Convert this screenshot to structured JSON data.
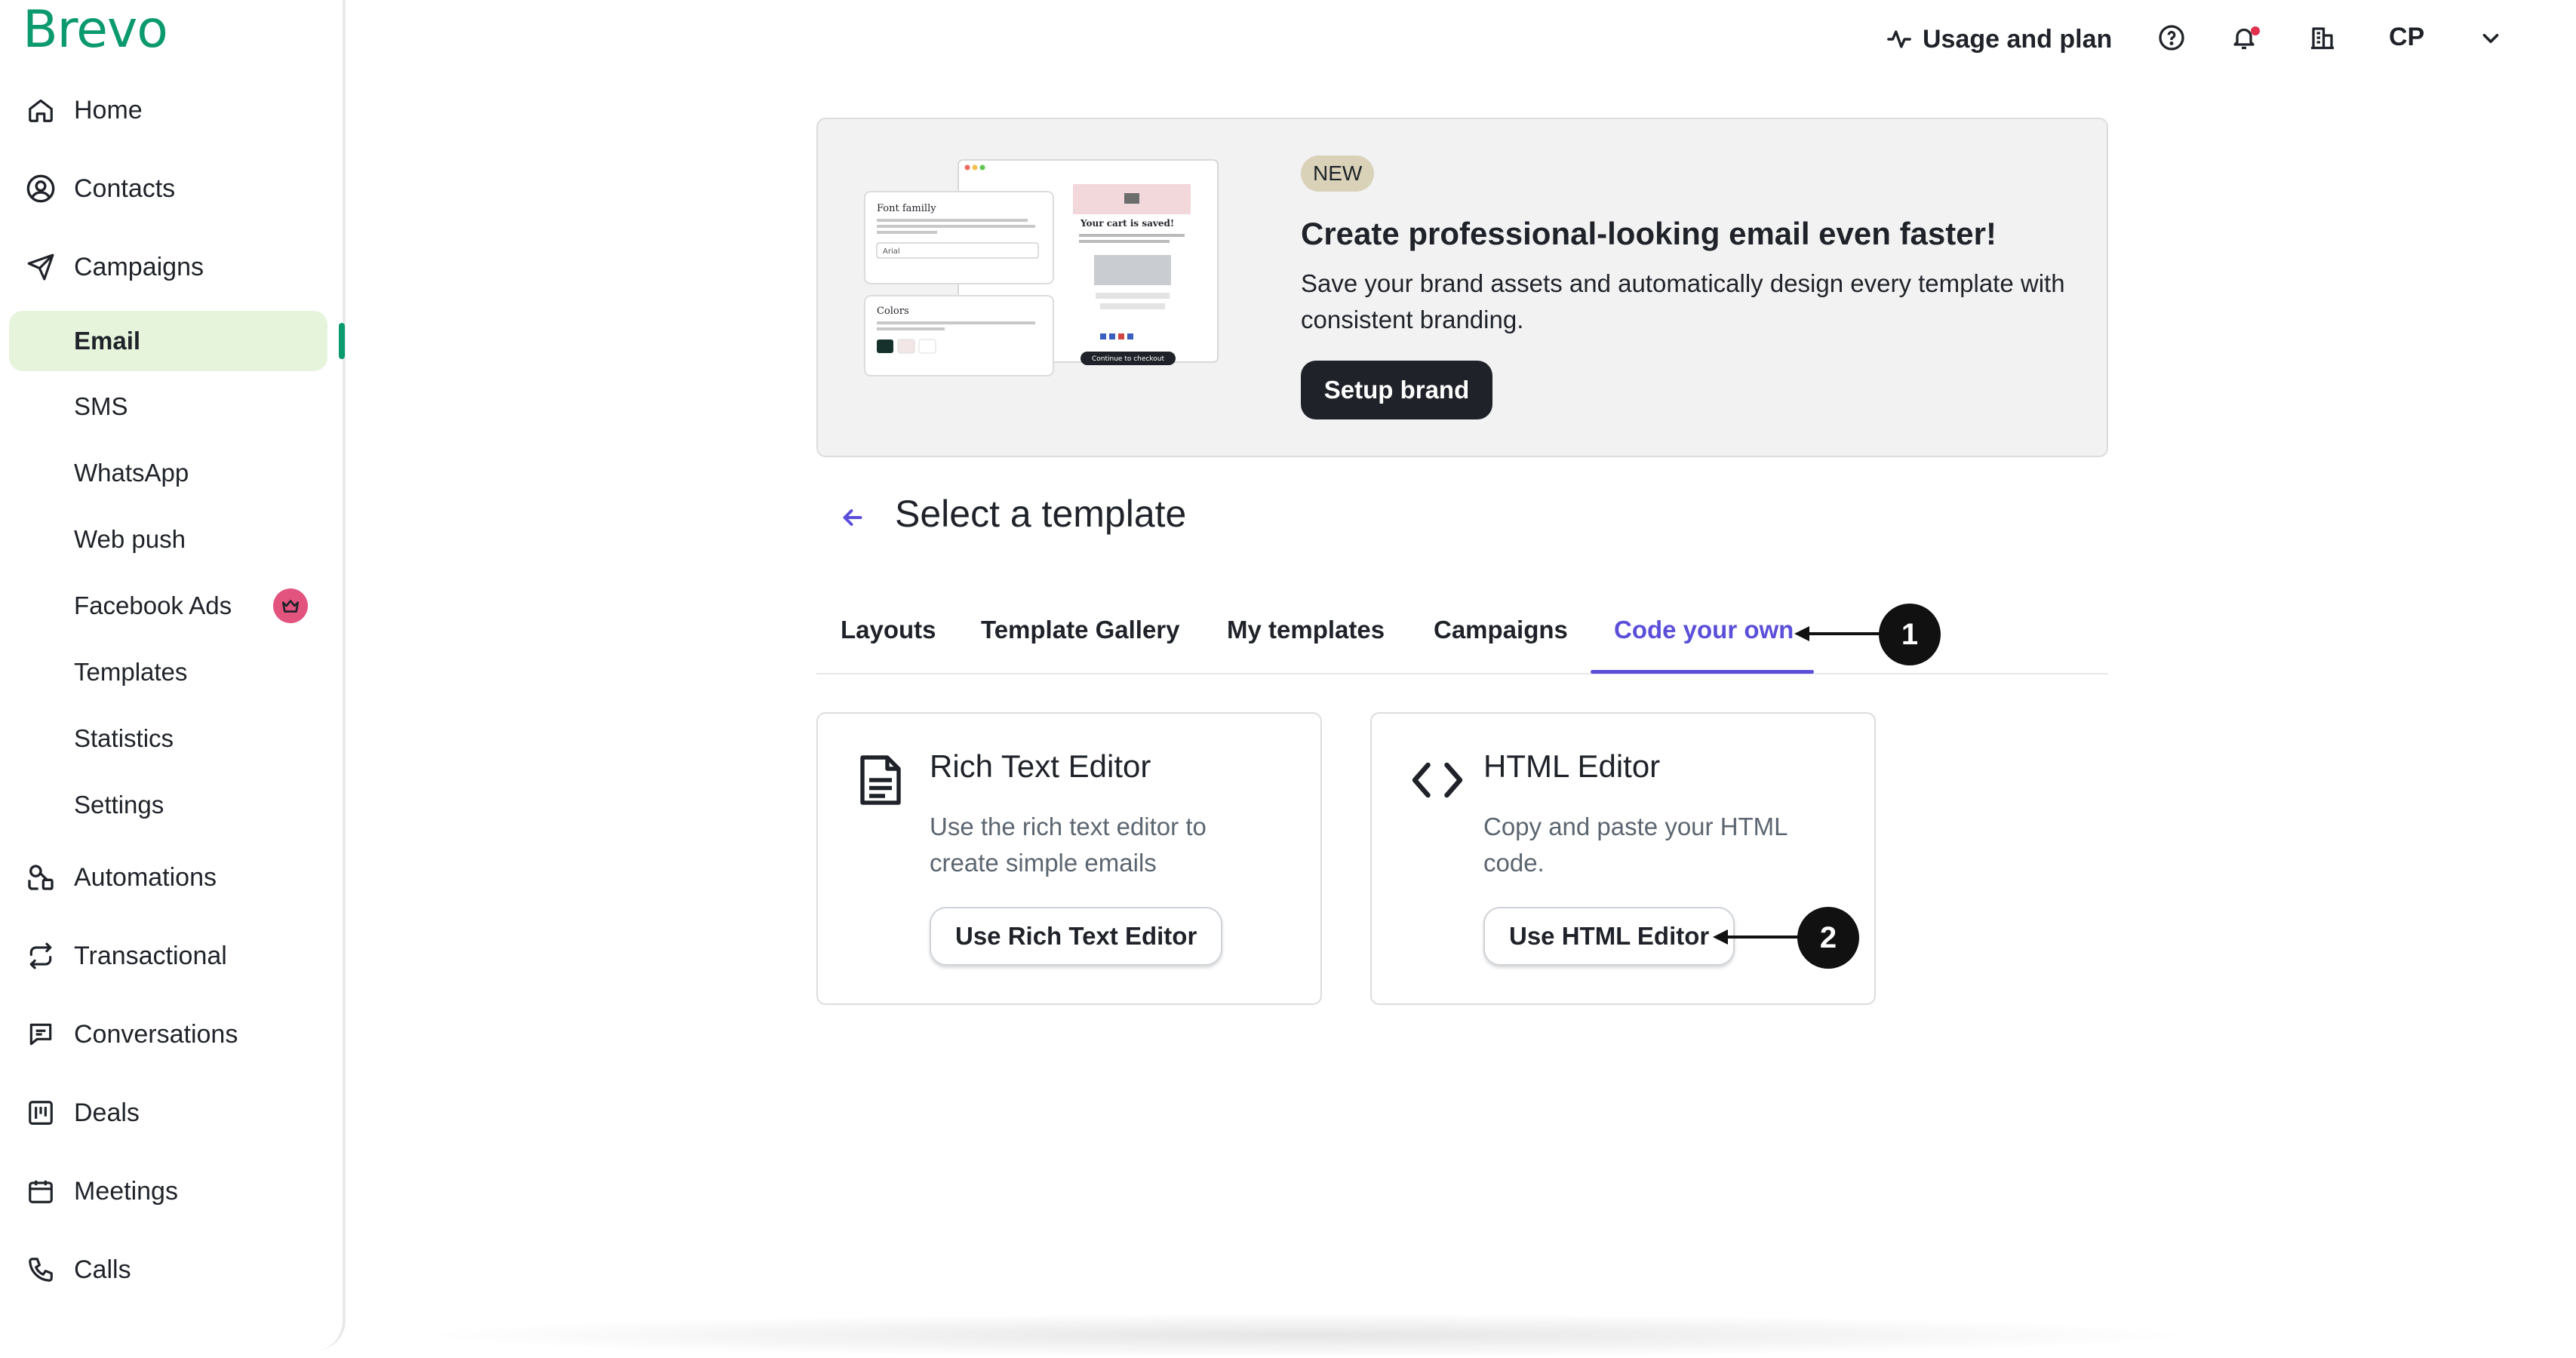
{
  "brand": {
    "logo_text": "Brevo",
    "accent_color": "#0b996e",
    "tab_accent_color": "#5b4fd9"
  },
  "sidebar": {
    "nav": [
      {
        "label": "Home",
        "icon": "home-icon"
      },
      {
        "label": "Contacts",
        "icon": "contacts-icon"
      },
      {
        "label": "Campaigns",
        "icon": "send-icon"
      }
    ],
    "campaign_sub": [
      {
        "label": "Email",
        "active": true
      },
      {
        "label": "SMS"
      },
      {
        "label": "WhatsApp"
      },
      {
        "label": "Web push"
      },
      {
        "label": "Facebook Ads",
        "badge_icon": "crown-icon"
      },
      {
        "label": "Templates"
      },
      {
        "label": "Statistics"
      },
      {
        "label": "Settings"
      }
    ],
    "nav_bottom": [
      {
        "label": "Automations",
        "icon": "automation-icon"
      },
      {
        "label": "Transactional",
        "icon": "transactional-icon"
      },
      {
        "label": "Conversations",
        "icon": "chat-icon"
      },
      {
        "label": "Deals",
        "icon": "deals-icon"
      },
      {
        "label": "Meetings",
        "icon": "calendar-icon"
      },
      {
        "label": "Calls",
        "icon": "phone-icon"
      }
    ]
  },
  "topbar": {
    "usage_label": "Usage and plan",
    "user_initials": "CP"
  },
  "banner": {
    "badge": "NEW",
    "title": "Create professional-looking email even faster!",
    "description": "Save your brand assets and automatically design every template with consistent branding.",
    "button": "Setup brand",
    "illustration": {
      "font_label": "Font familly",
      "font_value": "Arial",
      "colors_label": "Colors",
      "cart_title": "Your cart is saved!",
      "cta": "Continue to checkout"
    }
  },
  "page": {
    "title": "Select a template"
  },
  "tabs": [
    {
      "label": "Layouts"
    },
    {
      "label": "Template Gallery"
    },
    {
      "label": "My templates"
    },
    {
      "label": "Campaigns"
    },
    {
      "label": "Code your own",
      "active": true
    }
  ],
  "cards": [
    {
      "title": "Rich Text Editor",
      "description": "Use the rich text editor to create simple emails",
      "button": "Use Rich Text Editor",
      "icon": "document-icon"
    },
    {
      "title": "HTML Editor",
      "description": "Copy and paste your HTML code.",
      "button": "Use HTML Editor",
      "icon": "code-icon"
    }
  ],
  "annotations": [
    {
      "number": "1"
    },
    {
      "number": "2"
    }
  ]
}
